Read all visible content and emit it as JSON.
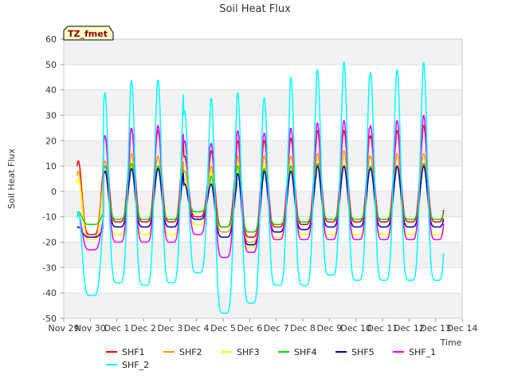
{
  "chart_data": {
    "type": "line",
    "title": "Soil Heat Flux",
    "xlabel": "Time",
    "ylabel": "Soil Heat Flux",
    "station_badge": "TZ_fmet",
    "ylim": [
      -50,
      60
    ],
    "yticks": [
      -50,
      -40,
      -30,
      -20,
      -10,
      0,
      10,
      20,
      30,
      40,
      50,
      60
    ],
    "xlim": [
      0,
      15
    ],
    "xtick_labels": [
      "Nov 29",
      "Nov 30",
      "Dec 1",
      "Dec 2",
      "Dec 3",
      "Dec 4",
      "Dec 5",
      "Dec 6",
      "Dec 7",
      "Dec 8",
      "Dec 9",
      "Dec 10",
      "Dec 11",
      "Dec 12",
      "Dec 13",
      "Dec 14"
    ],
    "grid": true,
    "legend_position": "bottom",
    "series": [
      {
        "name": "SHF1",
        "color": "#ff0000",
        "days": [
          0.5,
          1,
          2,
          3,
          4,
          5,
          6,
          7,
          8,
          9,
          10,
          11,
          12,
          13,
          14.3
        ],
        "peaks": [
          12,
          22,
          25,
          24,
          14,
          16,
          20,
          20,
          21,
          24,
          24,
          22,
          24,
          26,
          23
        ],
        "troughs": [
          -17,
          -12,
          -12,
          -12,
          -10,
          -14,
          -18,
          -14,
          -13,
          -12,
          -12,
          -12,
          -12,
          -12,
          -13
        ]
      },
      {
        "name": "SHF2",
        "color": "#ff9900",
        "days": [
          0.5,
          1,
          2,
          3,
          4,
          5,
          6,
          7,
          8,
          9,
          10,
          11,
          12,
          13,
          14.3
        ],
        "peaks": [
          8,
          12,
          15,
          14,
          8,
          10,
          14,
          14,
          14,
          15,
          16,
          14,
          15,
          15,
          14
        ],
        "troughs": [
          -18,
          -14,
          -14,
          -14,
          -11,
          -16,
          -20,
          -16,
          -15,
          -14,
          -14,
          -14,
          -14,
          -14,
          -14
        ]
      },
      {
        "name": "SHF3",
        "color": "#ffff00",
        "days": [
          0.5,
          1,
          2,
          3,
          4,
          5,
          6,
          7,
          8,
          9,
          10,
          11,
          12,
          13,
          14.3
        ],
        "peaks": [
          5,
          8,
          10,
          10,
          5,
          8,
          10,
          10,
          10,
          11,
          11,
          10,
          10,
          11,
          10
        ],
        "troughs": [
          -19,
          -17,
          -17,
          -17,
          -13,
          -18,
          -22,
          -18,
          -17,
          -17,
          -17,
          -17,
          -17,
          -17,
          -17
        ]
      },
      {
        "name": "SHF4",
        "color": "#00dd00",
        "days": [
          0.5,
          1,
          2,
          3,
          4,
          5,
          6,
          7,
          8,
          9,
          10,
          11,
          12,
          13,
          14.3
        ],
        "peaks": [
          -8,
          10,
          11,
          10,
          3,
          6,
          10,
          9,
          10,
          11,
          10,
          10,
          10,
          11,
          10
        ],
        "troughs": [
          -13,
          -11,
          -11,
          -11,
          -8,
          -14,
          -16,
          -13,
          -12,
          -11,
          -11,
          -11,
          -11,
          -11,
          -11
        ]
      },
      {
        "name": "SHF5",
        "color": "#0000cc",
        "days": [
          0.5,
          1,
          2,
          3,
          4,
          5,
          6,
          7,
          8,
          9,
          10,
          11,
          12,
          13,
          14.3
        ],
        "peaks": [
          -14,
          8,
          9,
          9,
          3,
          3,
          7,
          8,
          8,
          10,
          10,
          9,
          10,
          10,
          9
        ],
        "troughs": [
          -18,
          -14,
          -14,
          -14,
          -11,
          -18,
          -21,
          -16,
          -15,
          -14,
          -14,
          -14,
          -14,
          -14,
          -15
        ]
      },
      {
        "name": "SHF_1",
        "color": "#ee00ee",
        "days": [
          0.5,
          1,
          2,
          3,
          4,
          5,
          6,
          7,
          8,
          9,
          10,
          11,
          12,
          13,
          14.3
        ],
        "peaks": [
          -9,
          22,
          25,
          26,
          20,
          19,
          24,
          23,
          25,
          27,
          28,
          26,
          28,
          30,
          26
        ],
        "troughs": [
          -23,
          -20,
          -20,
          -20,
          -17,
          -26,
          -24,
          -19,
          -19,
          -19,
          -19,
          -19,
          -19,
          -19,
          -18
        ]
      },
      {
        "name": "SHF_2",
        "color": "#00ffff",
        "days": [
          0.5,
          1,
          2,
          3,
          4,
          5,
          6,
          7,
          8,
          9,
          10,
          11,
          12,
          13,
          14.3
        ],
        "peaks": [
          -8,
          39,
          44,
          44,
          32,
          37,
          39,
          37,
          45,
          48,
          51,
          47,
          48,
          51,
          47
        ],
        "troughs": [
          -41,
          -36,
          -37,
          -36,
          -32,
          -48,
          -44,
          -37,
          -37,
          -33,
          -35,
          -35,
          -35,
          -35,
          -33
        ]
      }
    ]
  }
}
